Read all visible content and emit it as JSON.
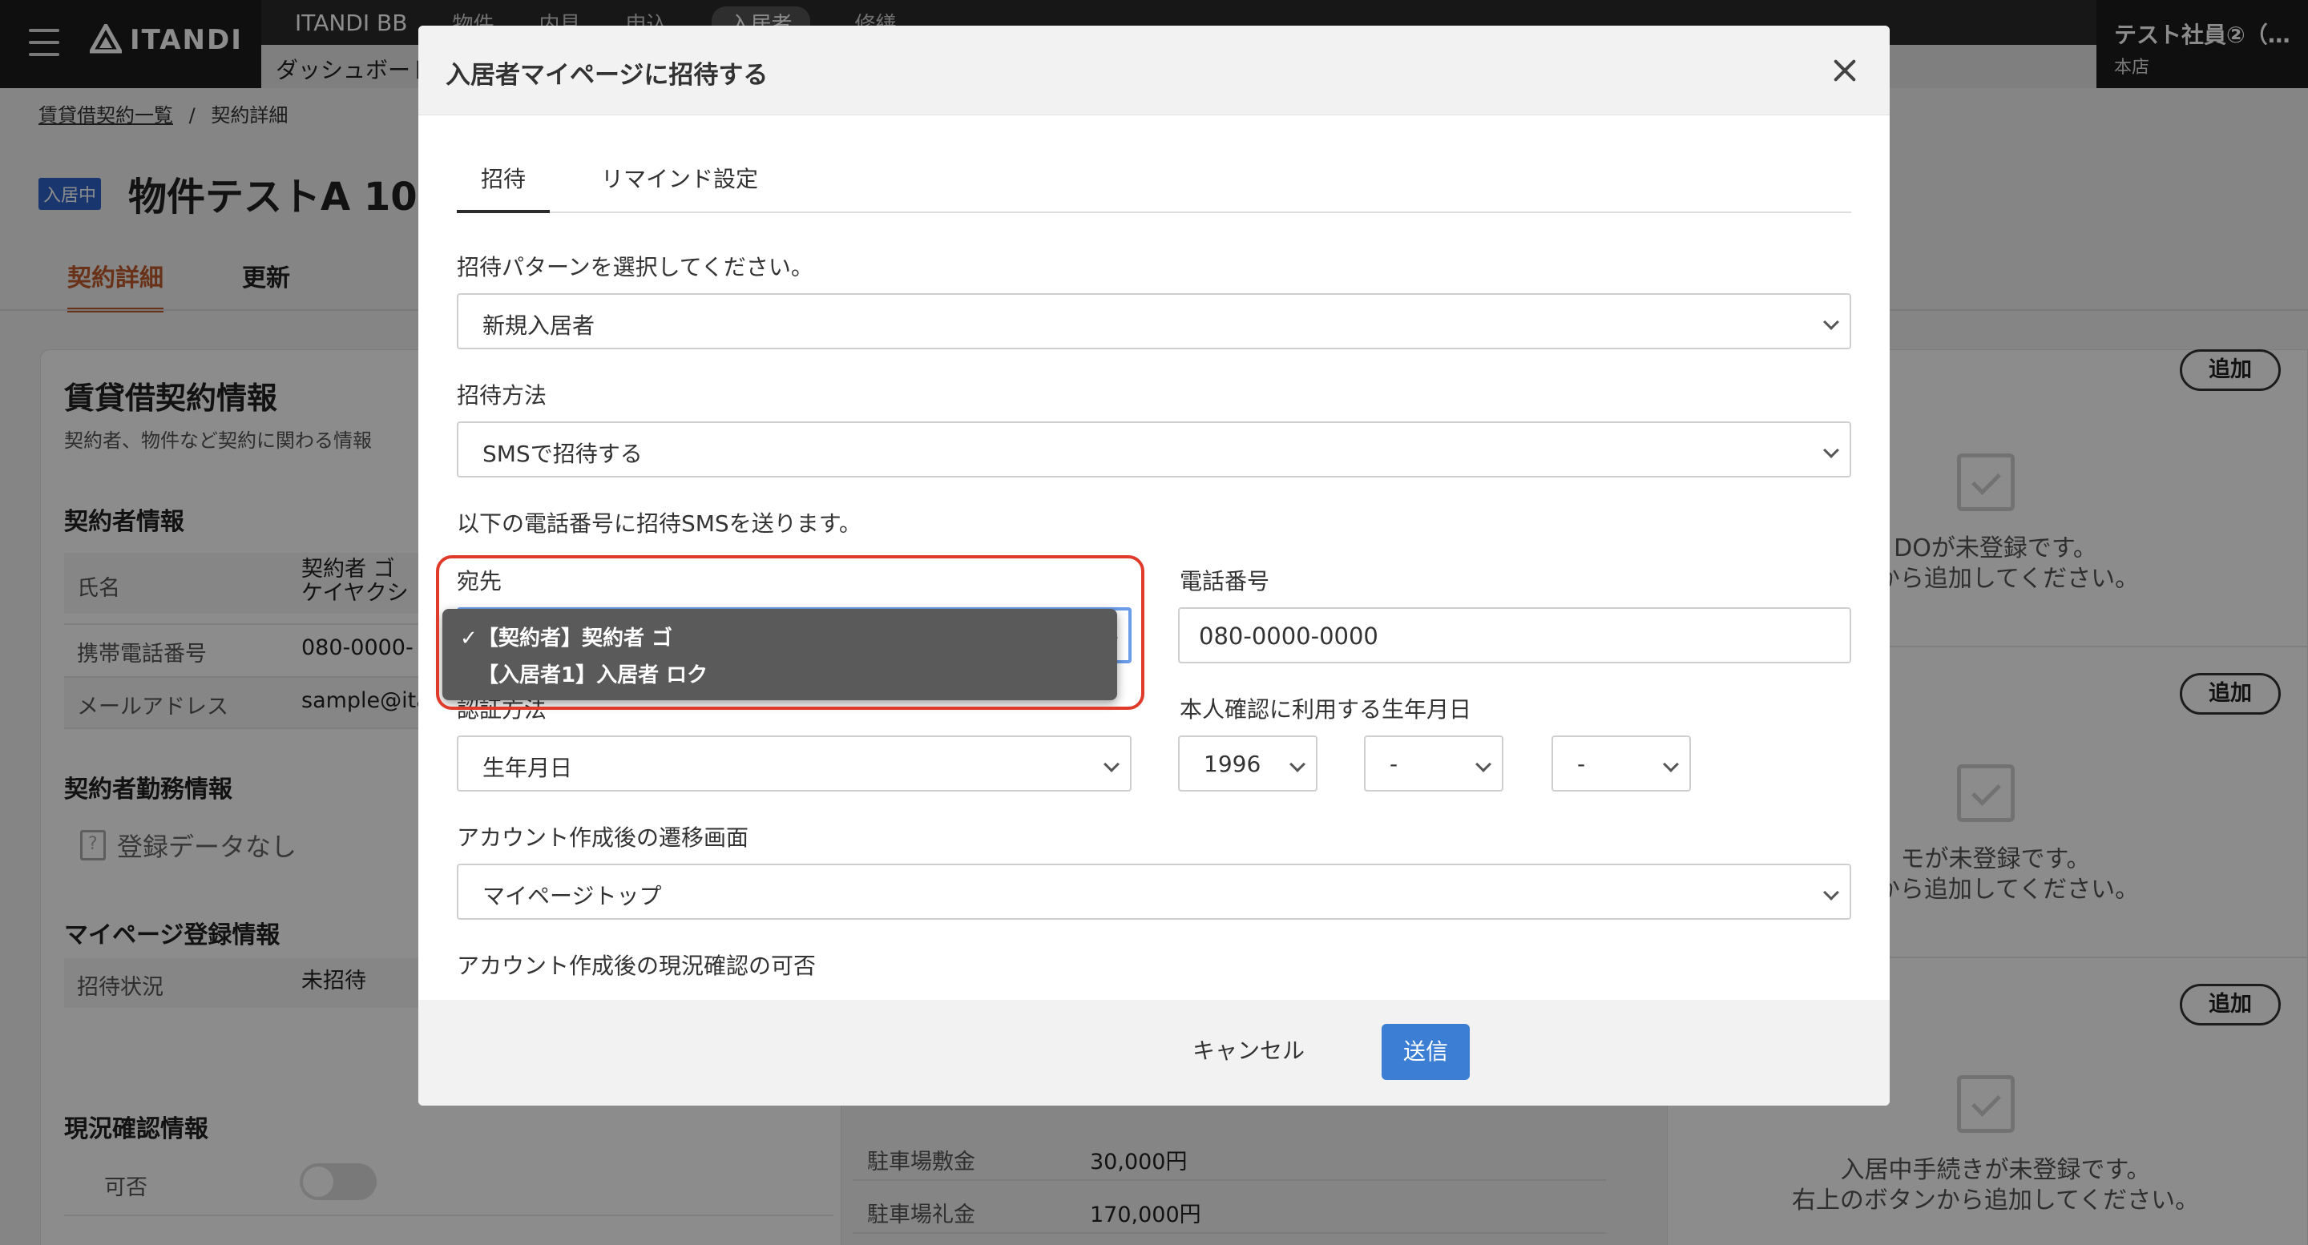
{
  "header": {
    "logo_text": "ITANDI",
    "nav_brand": "ITANDI BB",
    "nav_items": [
      "物件",
      "内見",
      "申込",
      "入居者",
      "修繕"
    ],
    "sub_nav": "ダッシュボード",
    "user_name": "テスト社員②（…",
    "user_branch": "本店"
  },
  "page": {
    "breadcrumb_link": "賃貸借契約一覧",
    "breadcrumb_sep": "/",
    "breadcrumb_current": "契約詳細",
    "status_chip": "入居中",
    "property_title": "物件テストA 100",
    "tabs": [
      "契約詳細",
      "更新"
    ],
    "card_title": "賃貸借契約情報",
    "card_subtitle": "契約者、物件など契約に関わる情報",
    "contractor_section": "契約者情報",
    "rows": [
      {
        "label": "氏名",
        "value1": "契約者 ゴ",
        "value2": "ケイヤクシ"
      },
      {
        "label": "携帯電話番号",
        "value1": "080-0000-"
      },
      {
        "label": "メールアドレス",
        "value1": "sample@ita"
      }
    ],
    "work_section": "契約者勤務情報",
    "no_data": "登録データなし",
    "mypage_section": "マイページ登録情報",
    "invite_status_label": "招待状況",
    "invite_status_value": "未招待",
    "status_section": "現況確認情報",
    "status_label": "可否",
    "mid_rows": [
      {
        "label": "駐車場敷金",
        "value": "30,000円"
      },
      {
        "label": "駐車場礼金",
        "value": "170,000円"
      }
    ],
    "right_add_label": "追加",
    "right_empty": [
      {
        "line1": "DOが未登録です。",
        "line2": "ンから追加してください。"
      },
      {
        "line1": "モが未登録です。",
        "line2": "ンから追加してください。"
      },
      {
        "line1": "入居中手続きが未登録です。",
        "line2": "右上のボタンから追加してください。"
      }
    ]
  },
  "modal": {
    "title": "入居者マイページに招待する",
    "tabs": [
      "招待",
      "リマインド設定"
    ],
    "pattern_label": "招待パターンを選択してください。",
    "pattern_value": "新規入居者",
    "method_label": "招待方法",
    "method_value": "SMSで招待する",
    "sms_note": "以下の電話番号に招待SMSを送ります。",
    "recipient_label": "宛先",
    "recipient_options": [
      {
        "label": "【契約者】契約者 ゴ",
        "selected": true
      },
      {
        "label": "【入居者1】入居者 ロク",
        "selected": false
      }
    ],
    "check_mark": "✓",
    "phone_label": "電話番号",
    "phone_value": "080-0000-0000",
    "auth_label": "認証方法",
    "auth_value": "生年月日",
    "birth_label": "本人確認に利用する生年月日",
    "birth_year": "1996",
    "birth_month": "-",
    "birth_day": "-",
    "after_screen_label": "アカウント作成後の遷移画面",
    "after_screen_value": "マイページトップ",
    "after_check_label": "アカウント作成後の現況確認の可否",
    "cancel_label": "キャンセル",
    "send_label": "送信"
  },
  "colors": {
    "accent": "#c05a2a",
    "primary_button": "#3b7ed3",
    "highlight": "#e03b2a",
    "status_chip": "#2e63c8"
  }
}
